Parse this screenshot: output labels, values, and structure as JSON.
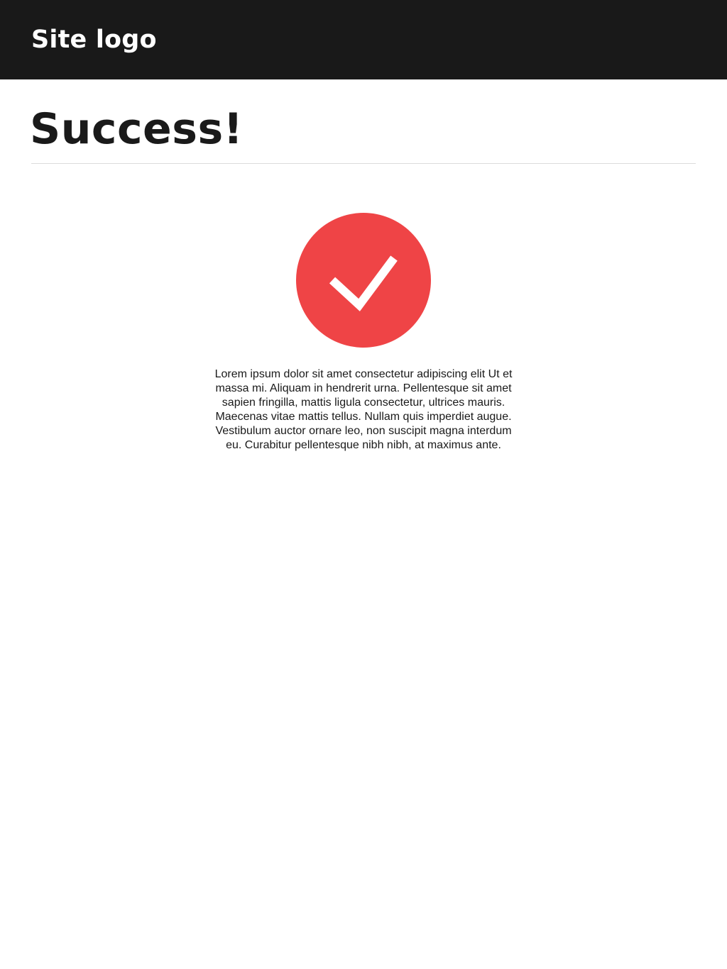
{
  "header": {
    "logo_text": "Site logo",
    "background_color": "#191919"
  },
  "main": {
    "title": "Success!",
    "status_icon": "checkmark-icon",
    "status_color": "#ef4446",
    "message": "Lorem ipsum dolor sit amet consectetur adipiscing elit Ut et massa mi. Aliquam in hendrerit urna. Pellentesque sit amet sapien fringilla, mattis ligula consectetur, ultrices mauris. Maecenas vitae mattis tellus. Nullam quis imperdiet augue. Vestibulum auctor ornare leo, non suscipit magna interdum eu. Curabitur pellentesque nibh nibh, at maximus ante."
  }
}
